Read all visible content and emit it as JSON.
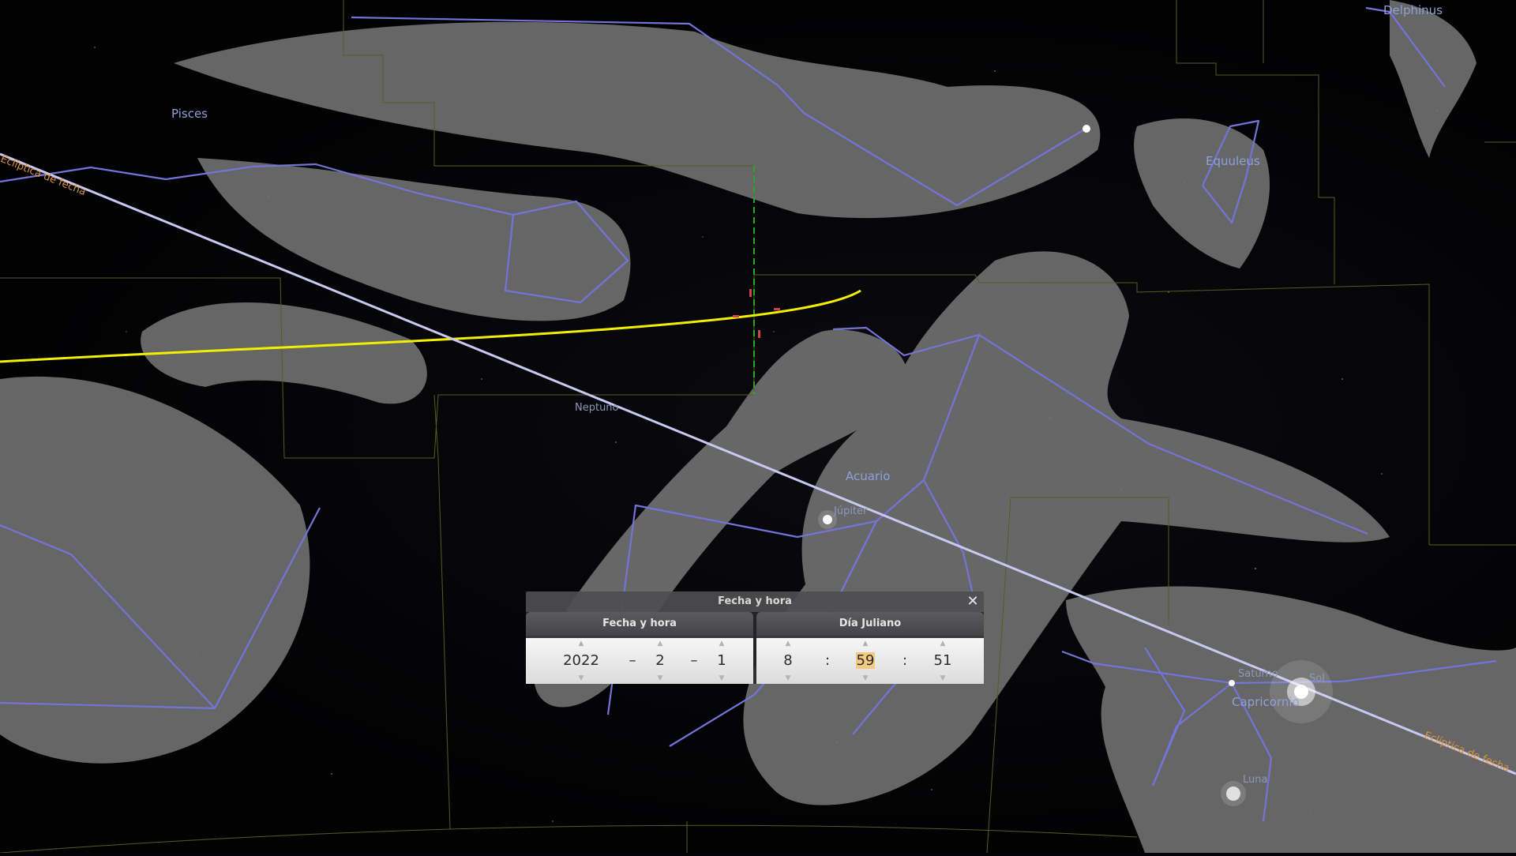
{
  "sky": {
    "constellations": [
      "Pisces",
      "Delphinus",
      "Equuleus",
      "Acuario",
      "Capricornio"
    ],
    "planets": [
      "Neptuno",
      "Júpiter",
      "Saturno",
      "Sol",
      "Luna"
    ],
    "ecliptic_label": "Eclíptica de fecha",
    "colors": {
      "constellation_lines": "#7474d8",
      "ecliptic_line": "#c8c8f0",
      "planet_orbit": "#f2f000",
      "boundaries": "#5a5a22",
      "meridian": "#22aa22"
    }
  },
  "dialog": {
    "title": "Fecha y hora",
    "close_icon": "close-icon",
    "date_tab": {
      "title": "Fecha y hora",
      "year": "2022",
      "month": "2",
      "day": "1",
      "separator": "–"
    },
    "jd_tab": {
      "title": "Día Juliano",
      "hour": "8",
      "minute": "59",
      "second": "51",
      "separator": ":"
    }
  }
}
